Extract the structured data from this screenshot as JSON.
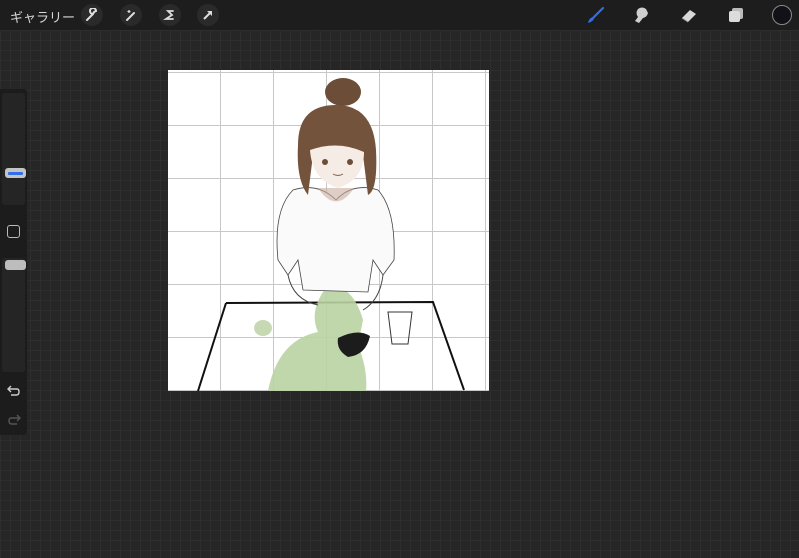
{
  "topbar": {
    "gallery_label": "ギャラリー",
    "left_tools": [
      "wrench-icon",
      "magic-wand-icon",
      "selection-icon",
      "transform-arrow-icon"
    ],
    "right_tools": [
      "brush-icon",
      "smudge-icon",
      "eraser-icon",
      "layers-icon",
      "color-icon"
    ],
    "accent_color": "#2f6fe8",
    "current_color": "#111118"
  },
  "sidebar": {
    "brush_size_fraction": 0.3,
    "opacity_fraction": 0.95
  }
}
